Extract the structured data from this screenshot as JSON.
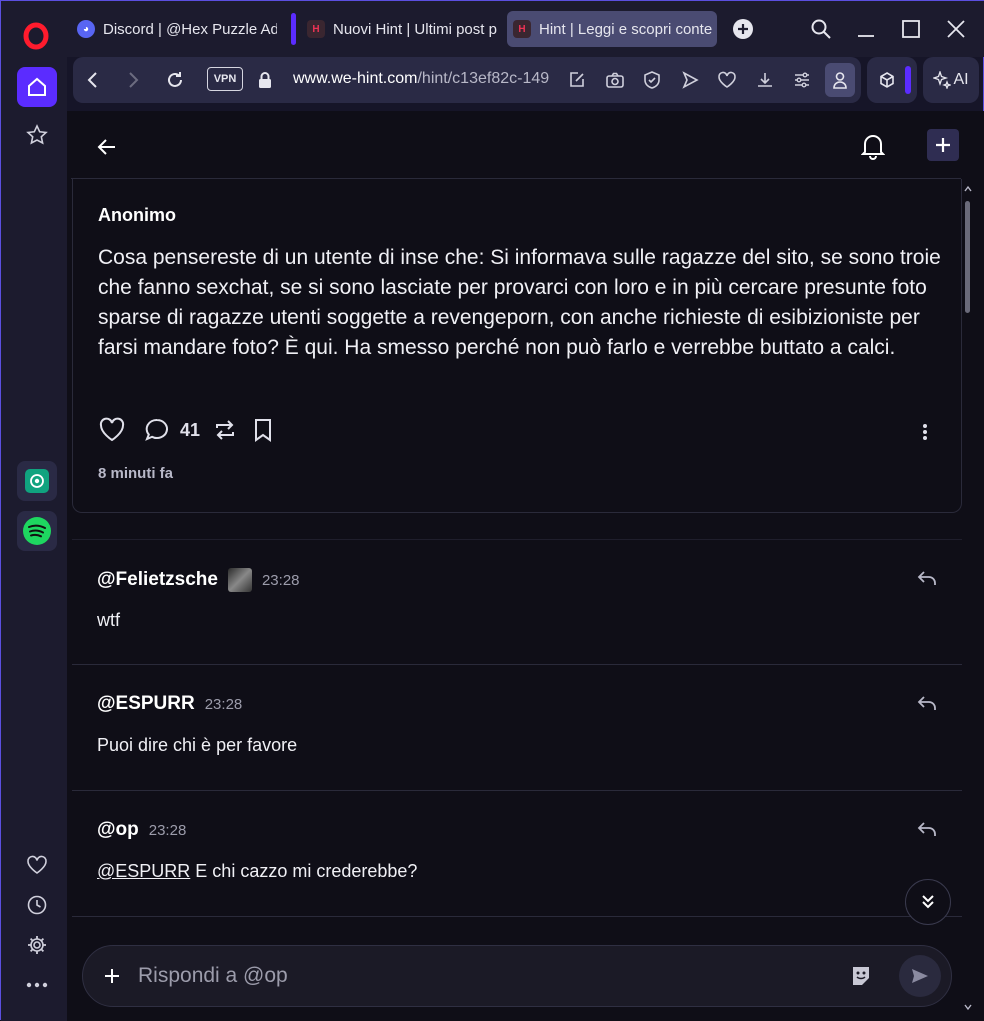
{
  "tabs": [
    {
      "label": "Discord | @Hex Puzzle Ad",
      "active": false,
      "icon": "discord-icon"
    },
    {
      "label": "Nuovi Hint | Ultimi post p",
      "active": false,
      "icon": "hint-icon"
    },
    {
      "label": "Hint | Leggi e scopri conte",
      "active": true,
      "icon": "hint-icon"
    }
  ],
  "address": {
    "vpn_label": "VPN",
    "url_host": "www.we-hint.com",
    "url_path": "/hint/c13ef82c-149"
  },
  "ai_button_label": "AI",
  "post": {
    "author": "Anonimo",
    "text": "Cosa pensereste di un utente di inse che: Si informava sulle ragazze del sito, se sono troie che fanno sexchat, se si sono lasciate per provarci con loro e in più cercare presunte foto sparse di ragazze utenti soggette a revengeporn, con anche richieste di esibizioniste per farsi mandare foto? È qui. Ha smesso perché non può farlo e verrebbe buttato a calci.",
    "comment_count": "41",
    "time_ago": "8 minuti fa"
  },
  "comments": [
    {
      "user": "@Felietzsche",
      "time": "23:28",
      "text": "wtf",
      "mention": ""
    },
    {
      "user": "@ESPURR",
      "time": "23:28",
      "text": "Puoi dire chi è per favore",
      "mention": ""
    },
    {
      "user": "@op",
      "time": "23:28",
      "text": " E chi cazzo mi crederebbe?",
      "mention": "@ESPURR"
    }
  ],
  "composer": {
    "placeholder": "Rispondi a @op"
  },
  "colors": {
    "accent": "#5b2cff",
    "background": "#0f0e17",
    "chrome": "#1c1b2e"
  }
}
